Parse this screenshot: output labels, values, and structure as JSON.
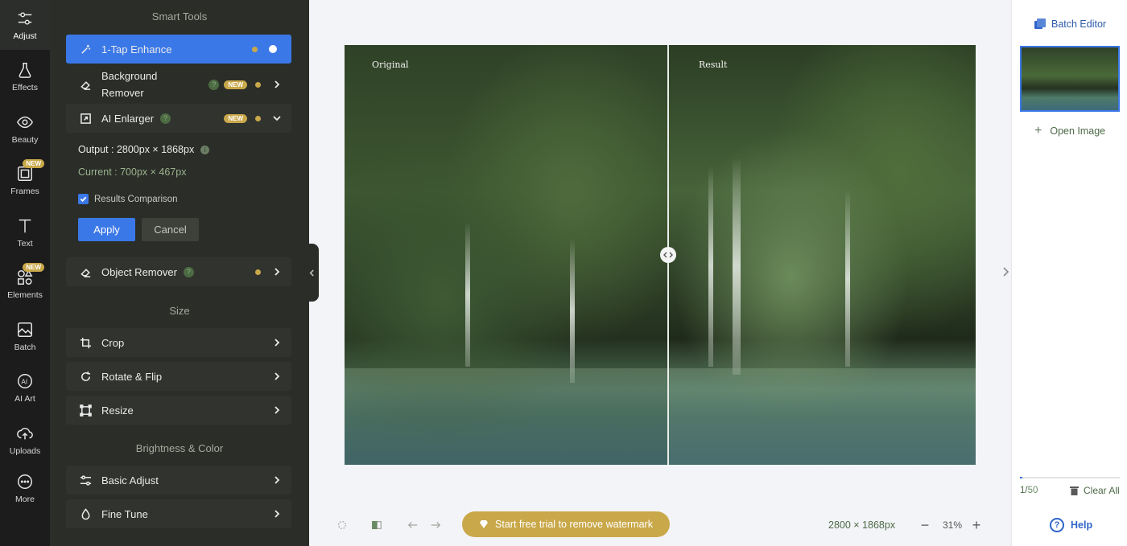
{
  "rail": {
    "items": [
      {
        "label": "Adjust",
        "icon": "sliders-icon",
        "active": true
      },
      {
        "label": "Effects",
        "icon": "flask-icon"
      },
      {
        "label": "Beauty",
        "icon": "eye-icon"
      },
      {
        "label": "Frames",
        "icon": "frame-icon",
        "badge": "NEW"
      },
      {
        "label": "Text",
        "icon": "text-icon"
      },
      {
        "label": "Elements",
        "icon": "shapes-icon",
        "badge": "NEW"
      },
      {
        "label": "Batch",
        "icon": "batch-icon"
      },
      {
        "label": "AI Art",
        "icon": "ai-icon"
      },
      {
        "label": "Uploads",
        "icon": "cloud-upload-icon"
      },
      {
        "label": "More",
        "icon": "more-icon"
      }
    ]
  },
  "panel": {
    "smart_tools_title": "Smart Tools",
    "one_tap": {
      "label": "1-Tap Enhance"
    },
    "bg_remover": {
      "label_line1": "Background",
      "label_line2": "Remover",
      "badge": "NEW"
    },
    "ai_enlarger": {
      "label": "AI Enlarger",
      "badge": "NEW",
      "output": "Output : 2800px × 1868px",
      "current": "Current : 700px × 467px",
      "comparison_label": "Results Comparison",
      "apply_label": "Apply",
      "cancel_label": "Cancel"
    },
    "object_remover": {
      "label": "Object Remover"
    },
    "size_title": "Size",
    "size_items": [
      "Crop",
      "Rotate & Flip",
      "Resize"
    ],
    "brightness_title": "Brightness & Color",
    "brightness_items": [
      "Basic Adjust",
      "Fine Tune"
    ]
  },
  "canvas": {
    "original_caption": "Original",
    "result_caption": "Result"
  },
  "bottom_bar": {
    "trial_label": "Start free trial to remove watermark",
    "dimensions": "2800 × 1868px",
    "zoom_minus": "−",
    "zoom": "31%",
    "zoom_plus": "+"
  },
  "right_panel": {
    "batch_editor": "Batch Editor",
    "open_image": "Open Image",
    "open_image_plus": "+",
    "pager_current": "1/",
    "pager_total": "50",
    "clear_all": "Clear All",
    "help": "Help",
    "help_icon": "?"
  },
  "colors": {
    "accent": "#3b78e7",
    "gold": "#c9a84a",
    "panel_bg": "#2a2d28",
    "rail_bg": "#1c1c1c"
  }
}
